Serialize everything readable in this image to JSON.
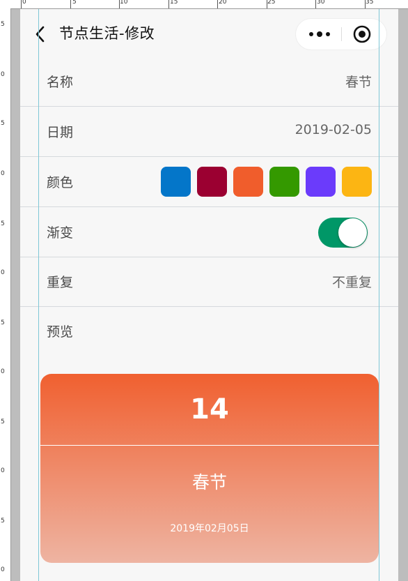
{
  "ruler": {
    "top_numbers": [
      "0",
      "5",
      "10",
      "15",
      "20",
      "25",
      "30",
      "35"
    ],
    "left_numbers": [
      "5",
      "0",
      "5",
      "0",
      "5",
      "0",
      "5",
      "0",
      "5",
      "0",
      "5",
      "0"
    ]
  },
  "nav": {
    "title": "节点生活-修改",
    "back_icon": "chevron-left-icon",
    "more_icon": "more-dots-icon",
    "close_icon": "target-circle-icon"
  },
  "form": {
    "name": {
      "label": "名称",
      "value": "春节"
    },
    "date": {
      "label": "日期",
      "value": "2019-02-05"
    },
    "color": {
      "label": "颜色",
      "options": [
        "#0476c9",
        "#9b0031",
        "#f05d2c",
        "#349900",
        "#6b3bfb",
        "#fcb513"
      ],
      "selected": "#f05d2c"
    },
    "gradient": {
      "label": "渐变",
      "enabled": true,
      "on_color": "#009767"
    },
    "repeat": {
      "label": "重复",
      "value": "不重复"
    },
    "preview": {
      "label": "预览"
    }
  },
  "preview_card": {
    "count": "14",
    "name": "春节",
    "date": "2019年02月05日",
    "gradient_from": "#f06030",
    "gradient_to": "#eeb4a2"
  }
}
